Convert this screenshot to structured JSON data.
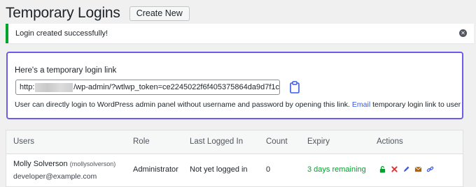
{
  "header": {
    "title": "Temporary Logins",
    "create_label": "Create New"
  },
  "notice": {
    "message": "Login created successfully!",
    "dismiss_icon": "close-circle-icon",
    "accent": "#00a32a"
  },
  "link_box": {
    "heading": "Here's a temporary login link",
    "url_prefix": "http:",
    "url_suffix": "/wp-admin/?wtlwp_token=ce2245022f6f405375864da9d7f1c",
    "copy_icon": "clipboard-icon",
    "desc_before": "User can directly login to WordPress admin panel without username and password by opening this link.",
    "desc_link": "Email",
    "desc_after": "temporary login link to user",
    "border_color": "#6c5ce7",
    "link_color": "#3858e9"
  },
  "table": {
    "headers": {
      "users": "Users",
      "role": "Role",
      "last": "Last Logged In",
      "count": "Count",
      "expiry": "Expiry",
      "actions": "Actions"
    },
    "rows": [
      {
        "name": "Molly Solverson",
        "username": "(mollysolverson)",
        "email": "developer@example.com",
        "role": "Administrator",
        "last": "Not yet logged in",
        "count": "0",
        "expiry": "3 days remaining",
        "actions": [
          "lock-icon",
          "delete-icon",
          "edit-icon",
          "email-icon",
          "link-icon"
        ]
      }
    ]
  }
}
